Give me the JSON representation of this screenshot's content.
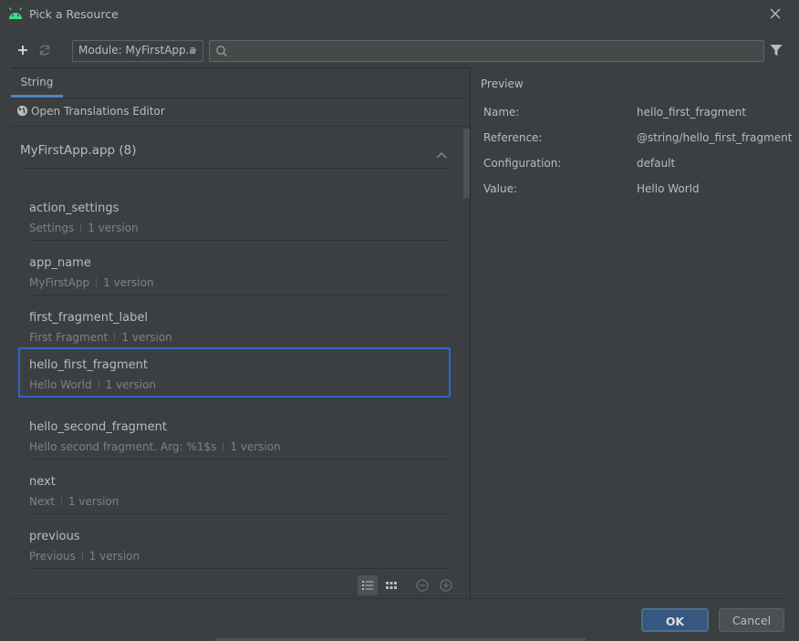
{
  "window": {
    "title": "Pick a Resource",
    "icon": "android-icon",
    "accent_color": "#4a88c7"
  },
  "toolbar": {
    "add_icon": "plus-icon",
    "refresh_icon": "refresh-icon",
    "module_selected": "Module: MyFirstApp.a",
    "search_value": "",
    "search_icon": "search-icon",
    "filter_icon": "filter-icon"
  },
  "tabs": [
    {
      "label": "String",
      "active": true
    }
  ],
  "translations_link": "Open Translations Editor",
  "group": {
    "label": "MyFirstApp.app (8)",
    "expanded": true
  },
  "resources": [
    {
      "name": "action_settings",
      "value": "Settings",
      "versions": "1 version"
    },
    {
      "name": "app_name",
      "value": "MyFirstApp",
      "versions": "1 version"
    },
    {
      "name": "first_fragment_label",
      "value": "First Fragment",
      "versions": "1 version"
    },
    {
      "name": "hello_first_fragment",
      "value": "Hello World",
      "versions": "1 version",
      "selected": true
    },
    {
      "name": "hello_second_fragment",
      "value": "Hello second fragment. Arg: %1$s",
      "versions": "1 version"
    },
    {
      "name": "next",
      "value": "Next",
      "versions": "1 version"
    },
    {
      "name": "previous",
      "value": "Previous",
      "versions": "1 version"
    }
  ],
  "view_controls": {
    "list_view_icon": "list-view-icon",
    "grid_view_icon": "grid-view-icon",
    "zoom_out_icon": "zoom-out-icon",
    "zoom_in_icon": "zoom-in-icon",
    "active_view": "list"
  },
  "preview": {
    "heading": "Preview",
    "rows": [
      {
        "key": "Name:",
        "value": "hello_first_fragment"
      },
      {
        "key": "Reference:",
        "value": "@string/hello_first_fragment"
      },
      {
        "key": "Configuration:",
        "value": "default"
      },
      {
        "key": "Value:",
        "value": "Hello World"
      }
    ]
  },
  "buttons": {
    "ok": "OK",
    "cancel": "Cancel"
  }
}
